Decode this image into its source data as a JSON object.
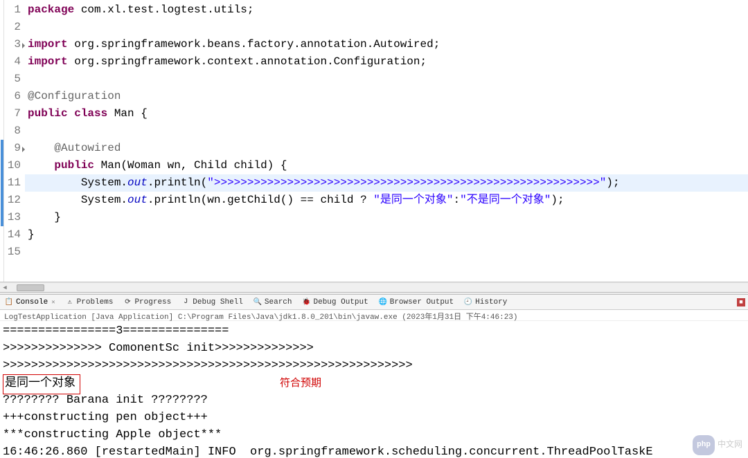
{
  "editor": {
    "lines": [
      {
        "n": 1,
        "tokens": [
          {
            "t": "package ",
            "c": "kw"
          },
          {
            "t": "com.xl.test.logtest.utils;",
            "c": "plain"
          }
        ]
      },
      {
        "n": 2,
        "tokens": []
      },
      {
        "n": 3,
        "dec": true,
        "tokens": [
          {
            "t": "import ",
            "c": "kw"
          },
          {
            "t": "org.springframework.beans.factory.annotation.Autowired;",
            "c": "plain"
          }
        ]
      },
      {
        "n": 4,
        "tokens": [
          {
            "t": "import ",
            "c": "kw"
          },
          {
            "t": "org.springframework.context.annotation.Configuration;",
            "c": "plain"
          }
        ]
      },
      {
        "n": 5,
        "tokens": []
      },
      {
        "n": 6,
        "tokens": [
          {
            "t": "@Configuration",
            "c": "ann"
          }
        ]
      },
      {
        "n": 7,
        "tokens": [
          {
            "t": "public class ",
            "c": "kw"
          },
          {
            "t": "Man {",
            "c": "plain"
          }
        ]
      },
      {
        "n": 8,
        "tokens": []
      },
      {
        "n": 9,
        "dec": true,
        "marker": true,
        "tokens": [
          {
            "t": "    ",
            "c": "plain"
          },
          {
            "t": "@Autowired",
            "c": "ann"
          }
        ]
      },
      {
        "n": 10,
        "marker": true,
        "tokens": [
          {
            "t": "    ",
            "c": "plain"
          },
          {
            "t": "public ",
            "c": "kw"
          },
          {
            "t": "Man(Woman wn, Child child) {",
            "c": "plain"
          }
        ]
      },
      {
        "n": 11,
        "highlight": true,
        "marker": true,
        "tokens": [
          {
            "t": "        System.",
            "c": "plain"
          },
          {
            "t": "out",
            "c": "field"
          },
          {
            "t": ".println(",
            "c": "plain"
          },
          {
            "t": "\">>>>>>>>>>>>>>>>>>>>>>>>>>>>>>>>>>>>>>>>>>>>>>>>>>>>>>>>>>\"",
            "c": "str"
          },
          {
            "t": ");",
            "c": "plain"
          }
        ]
      },
      {
        "n": 12,
        "marker": true,
        "tokens": [
          {
            "t": "        System.",
            "c": "plain"
          },
          {
            "t": "out",
            "c": "field"
          },
          {
            "t": ".println(wn.getChild() == child ? ",
            "c": "plain"
          },
          {
            "t": "\"是同一个对象\"",
            "c": "str"
          },
          {
            "t": ":",
            "c": "plain"
          },
          {
            "t": "\"不是同一个对象\"",
            "c": "str"
          },
          {
            "t": ");",
            "c": "plain"
          }
        ]
      },
      {
        "n": 13,
        "marker": true,
        "tokens": [
          {
            "t": "    }",
            "c": "plain"
          }
        ]
      },
      {
        "n": 14,
        "tokens": [
          {
            "t": "}",
            "c": "plain"
          }
        ]
      },
      {
        "n": 15,
        "tokens": []
      }
    ]
  },
  "tabs": [
    {
      "icon": "📋",
      "label": "Console",
      "close": true,
      "active": true
    },
    {
      "icon": "⚠",
      "label": "Problems"
    },
    {
      "icon": "⟳",
      "label": "Progress"
    },
    {
      "icon": "J",
      "label": "Debug Shell"
    },
    {
      "icon": "🔍",
      "label": "Search"
    },
    {
      "icon": "🐞",
      "label": "Debug Output"
    },
    {
      "icon": "🌐",
      "label": "Browser Output"
    },
    {
      "icon": "🕘",
      "label": "History"
    }
  ],
  "launch_info": "LogTestApplication [Java Application] C:\\Program Files\\Java\\jdk1.8.0_201\\bin\\javaw.exe (2023年1月31日 下午4:46:23)",
  "console": {
    "lines": [
      "================3===============",
      ">>>>>>>>>>>>>> ComonentSc init>>>>>>>>>>>>>>",
      ">>>>>>>>>>>>>>>>>>>>>>>>>>>>>>>>>>>>>>>>>>>>>>>>>>>>>>>>>>"
    ],
    "boxed": "是同一个对象",
    "annotation": "符合预期",
    "lines2": [
      "???????? Barana init ????????",
      "+++constructing pen object+++",
      "***constructing Apple object***",
      "16:46:26.860 [restartedMain] INFO  org.springframework.scheduling.concurrent.ThreadPoolTaskE"
    ]
  },
  "watermark": {
    "badge": "php",
    "text": "中文网"
  }
}
